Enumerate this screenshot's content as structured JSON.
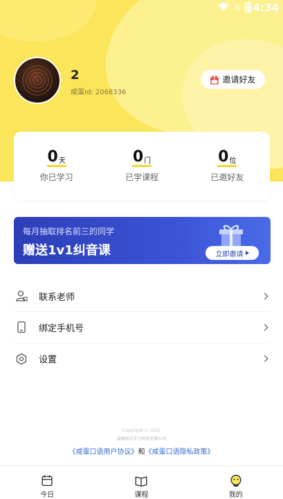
{
  "status_bar": {
    "sim": "无",
    "time": "4:34"
  },
  "profile": {
    "name": "2",
    "user_id": "咸蛋Id: 2068336"
  },
  "invite_button": {
    "label": "邀请好友",
    "icon": "gift-icon"
  },
  "stats": [
    {
      "value": "0",
      "unit": "天",
      "label": "你已学习"
    },
    {
      "value": "0",
      "unit": "门",
      "label": "已学课程"
    },
    {
      "value": "0",
      "unit": "位",
      "label": "已邀好友"
    }
  ],
  "banner": {
    "line1": "每月抽取排名前三的同学",
    "line2": "赠送1v1纠音课",
    "button": "立即邀请"
  },
  "menu": [
    {
      "label": "联系老师",
      "icon": "teacher-icon"
    },
    {
      "label": "绑定手机号",
      "icon": "phone-icon"
    },
    {
      "label": "设置",
      "icon": "settings-icon"
    }
  ],
  "footer": {
    "copyright": "Copyright © 2021",
    "company": "成都剖拉学习科技有限公司",
    "agreement": "《咸蛋口语用户协议》",
    "and": "和",
    "privacy": "《咸蛋口语隐私政策》"
  },
  "tabs": [
    {
      "label": "今日",
      "icon": "calendar-icon"
    },
    {
      "label": "课程",
      "icon": "book-icon"
    },
    {
      "label": "我的",
      "icon": "profile-icon"
    }
  ],
  "colors": {
    "hero": "#fbe55a",
    "accent_blue": "#2d3fb7",
    "link": "#3a6bd8"
  }
}
